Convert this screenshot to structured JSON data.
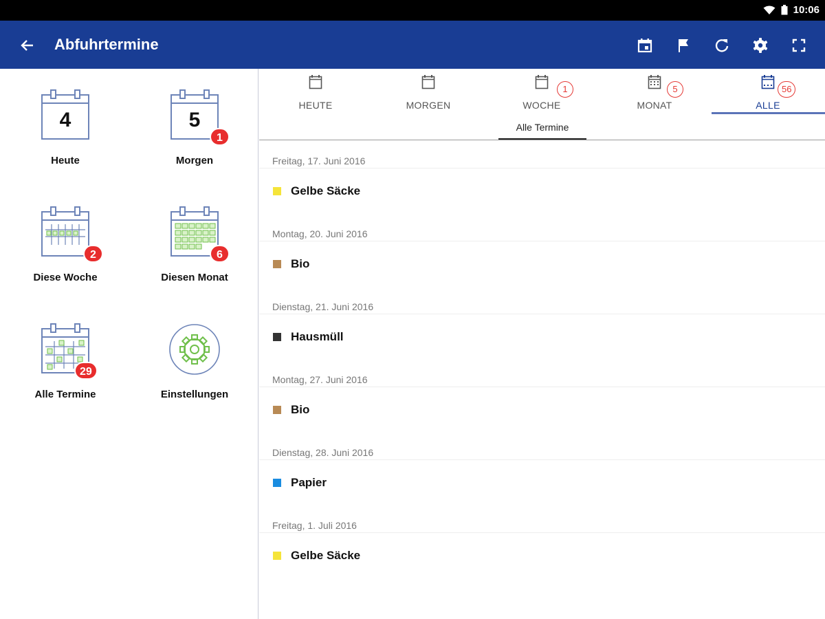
{
  "status": {
    "time": "10:06"
  },
  "appbar": {
    "title": "Abfuhrtermine",
    "actions": [
      "calendar-icon",
      "flag-icon",
      "refresh-icon",
      "settings-icon",
      "fullscreen-icon"
    ]
  },
  "tiles": [
    {
      "label": "Heute",
      "day": "4",
      "badge": ""
    },
    {
      "label": "Morgen",
      "day": "5",
      "badge": "1"
    },
    {
      "label": "Diese Woche",
      "badge": "2"
    },
    {
      "label": "Diesen Monat",
      "badge": "6"
    },
    {
      "label": "Alle Termine",
      "badge": "29"
    },
    {
      "label": "Einstellungen",
      "badge": ""
    }
  ],
  "tabs": [
    {
      "label": "HEUTE",
      "count": ""
    },
    {
      "label": "MORGEN",
      "count": ""
    },
    {
      "label": "WOCHE",
      "count": "1"
    },
    {
      "label": "MONAT",
      "count": "5"
    },
    {
      "label": "ALLE",
      "count": "56"
    }
  ],
  "subtab": {
    "label": "Alle Termine"
  },
  "colors": {
    "appbar": "#193d94",
    "badge": "#e82d2d",
    "gelbe_saecke": "#f5e43a",
    "bio": "#b88a55",
    "hausmuell": "#333333",
    "papier": "#1a8ce0"
  },
  "termine": [
    {
      "date": "Freitag, 17. Juni 2016",
      "label": "Gelbe Säcke",
      "color": "#f5e43a"
    },
    {
      "date": "Montag, 20. Juni 2016",
      "label": "Bio",
      "color": "#b88a55"
    },
    {
      "date": "Dienstag, 21. Juni 2016",
      "label": "Hausmüll",
      "color": "#333333"
    },
    {
      "date": "Montag, 27. Juni 2016",
      "label": "Bio",
      "color": "#b88a55"
    },
    {
      "date": "Dienstag, 28. Juni 2016",
      "label": "Papier",
      "color": "#1a8ce0"
    },
    {
      "date": "Freitag, 1. Juli 2016",
      "label": "Gelbe Säcke",
      "color": "#f5e43a"
    }
  ]
}
